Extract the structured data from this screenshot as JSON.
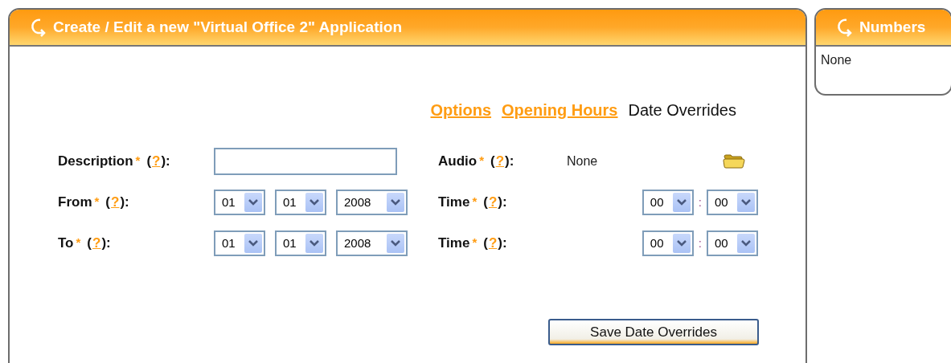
{
  "main_panel": {
    "title": "Create / Edit a new \"Virtual Office 2\" Application",
    "tabs": [
      {
        "label": "Options",
        "selected": false
      },
      {
        "label": "Opening Hours",
        "selected": false
      },
      {
        "label": "Date Overrides",
        "selected": true
      }
    ],
    "rows": [
      {
        "left": {
          "label": "Description",
          "mark": "*",
          "open": "(",
          "help": "?",
          "close": "):",
          "kind": "text"
        },
        "right": {
          "label": "Audio",
          "mark": "*",
          "open": "(",
          "help": "?",
          "close": "):",
          "kind": "file",
          "value": "None"
        }
      },
      {
        "left": {
          "label": "From",
          "mark": "*",
          "open": "(",
          "help": "?",
          "close": "):",
          "kind": "date",
          "selects": [
            "01",
            "01",
            "2008"
          ]
        },
        "right": {
          "label": "Time",
          "mark": "*",
          "open": "(",
          "help": "?",
          "close": "):",
          "kind": "time",
          "selects": [
            "00",
            "00"
          ],
          "separator": ":"
        }
      },
      {
        "left": {
          "label": "To",
          "mark": "*",
          "open": "(",
          "help": "?",
          "close": "):",
          "kind": "date",
          "selects": [
            "01",
            "01",
            "2008"
          ]
        },
        "right": {
          "label": "Time",
          "mark": "*",
          "open": "(",
          "help": "?",
          "close": "):",
          "kind": "time",
          "selects": [
            "00",
            "00"
          ],
          "separator": ":"
        }
      }
    ],
    "save_button": "Save Date Overrides"
  },
  "numbers_panel": {
    "title": "Numbers",
    "value": "None"
  }
}
